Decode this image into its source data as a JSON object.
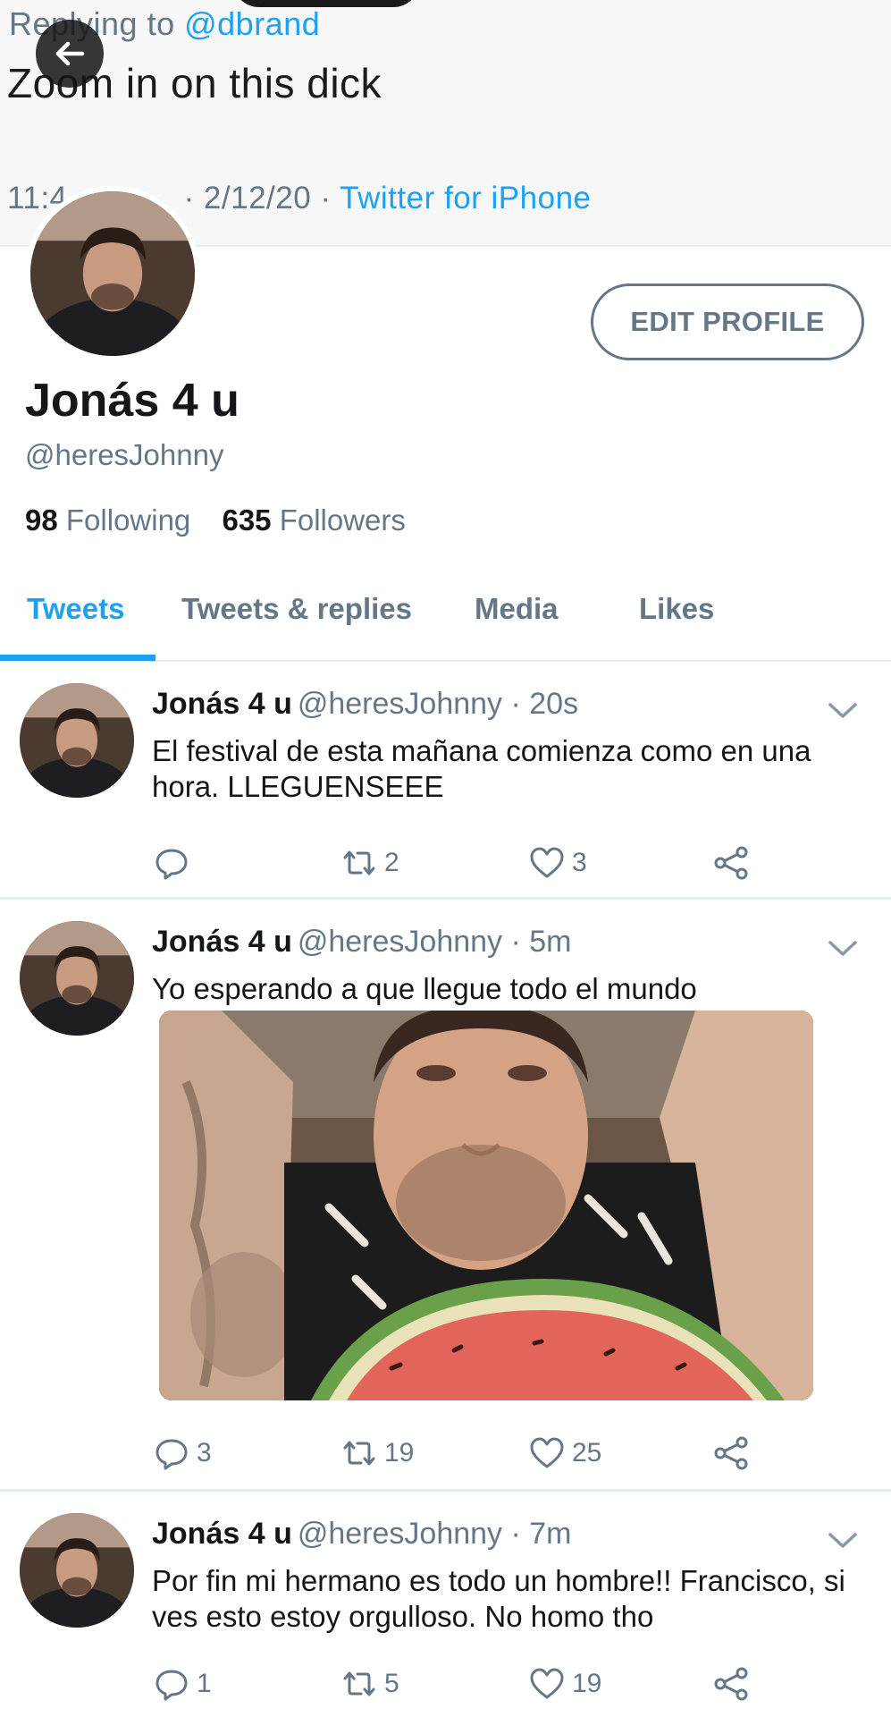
{
  "banner": {
    "replying_prefix": "Replying to ",
    "replying_handle": "@dbrand",
    "text": "Zoom in on this dick",
    "meta_time": "11:4",
    "meta_date": "· 2/12/20 · ",
    "meta_app": "Twitter for iPhone"
  },
  "profile": {
    "display_name": "Jonás 4 u",
    "handle": "@heresJohnny",
    "following_count": "98",
    "following_label": "Following",
    "followers_count": "635",
    "followers_label": "Followers",
    "edit_label": "EDIT PROFILE"
  },
  "tabs": [
    {
      "label": "Tweets",
      "active": true
    },
    {
      "label": "Tweets & replies",
      "active": false
    },
    {
      "label": "Media",
      "active": false
    },
    {
      "label": "Likes",
      "active": false
    }
  ],
  "tweets": [
    {
      "name": "Jonás 4 u",
      "handle": "@heresJohnny",
      "time": "· 20s",
      "text": "El festival de esta mañana comienza como en una hora. LLEGUENSEEE",
      "replies": "",
      "retweets": "2",
      "likes": "3"
    },
    {
      "name": "Jonás 4 u",
      "handle": "@heresJohnny",
      "time": "· 5m",
      "text": "Yo esperando a que llegue todo el mundo",
      "replies": "3",
      "retweets": "19",
      "likes": "25"
    },
    {
      "name": "Jonás 4 u",
      "handle": "@heresJohnny",
      "time": "· 7m",
      "text": "Por fin mi hermano es todo un hombre!! Francisco, si ves esto estoy orgulloso. No homo tho",
      "replies": "1",
      "retweets": "5",
      "likes": "19"
    }
  ],
  "colors": {
    "accent": "#1da1f2",
    "secondary_text": "#657786",
    "primary_text": "#14171a",
    "divider": "#e6ecf0"
  },
  "icons": [
    "back-arrow-icon",
    "reply-icon",
    "retweet-icon",
    "like-icon",
    "share-icon",
    "chevron-down-icon"
  ]
}
